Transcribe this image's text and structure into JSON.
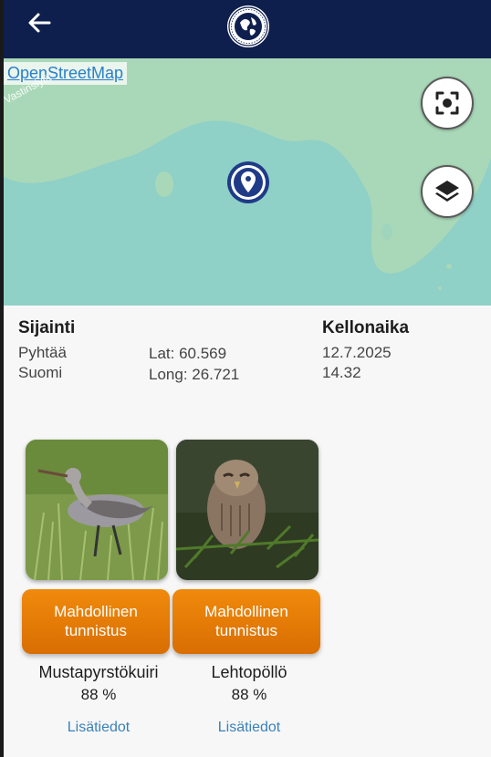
{
  "header": {
    "back_icon": "back-arrow-icon",
    "logo_icon": "globe-emblem-icon",
    "background": "#0f1f4d"
  },
  "map": {
    "attribution": "OpenStreetMap",
    "road_label": "Vastinsiylä",
    "focus_icon": "center-focus-icon",
    "layers_icon": "layers-icon",
    "marker_icon": "location-pin-icon",
    "land_color": "#a9d8b8",
    "water_color": "#8fd0c7"
  },
  "location": {
    "heading": "Sijainti",
    "place": "Pyhtää",
    "country": "Suomi",
    "lat": "Lat: 60.569",
    "long": "Long: 26.721"
  },
  "time": {
    "heading": "Kellonaika",
    "date": "12.7.2025",
    "clock": "14.32"
  },
  "results": [
    {
      "button": "Mahdollinen\ntunnistus",
      "species": "Mustapyrstökuiri",
      "confidence": "88 %",
      "more": "Lisätiedot"
    },
    {
      "button": "Mahdollinen\ntunnistus",
      "species": "Lehtopöllö",
      "confidence": "88 %",
      "more": "Lisätiedot"
    }
  ],
  "colors": {
    "accent": "#e37a07",
    "link": "#3a82b8"
  }
}
